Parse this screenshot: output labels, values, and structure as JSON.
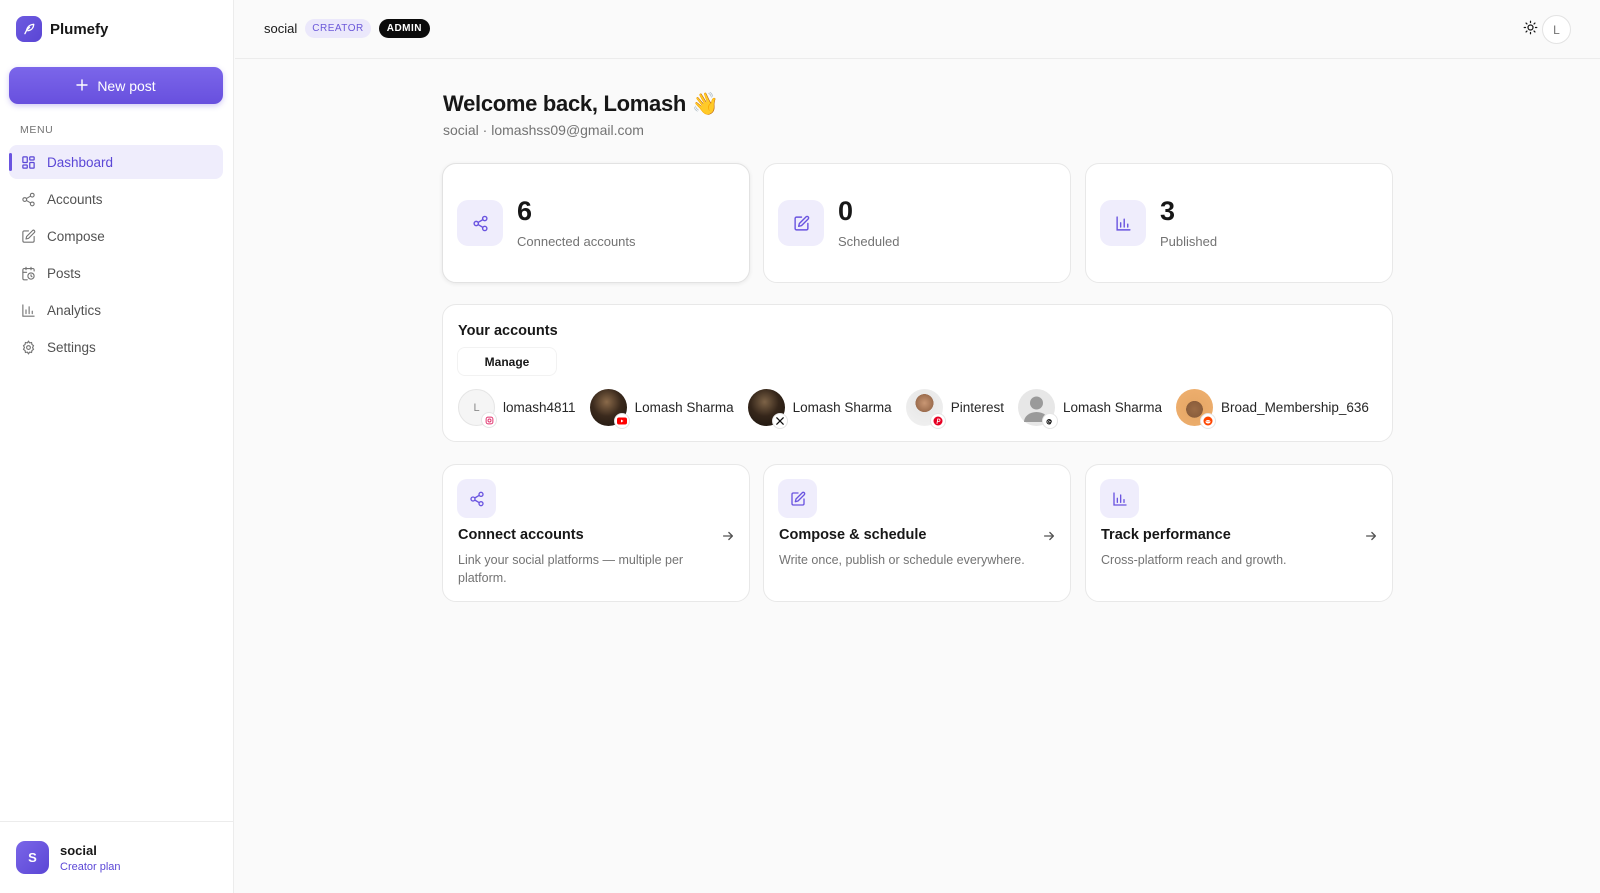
{
  "app": {
    "name": "Plumefy"
  },
  "sidebar": {
    "new_post_label": "New post",
    "menu_label": "MENU",
    "items": [
      {
        "label": "Dashboard",
        "icon": "grid-icon",
        "active": true
      },
      {
        "label": "Accounts",
        "icon": "share-icon"
      },
      {
        "label": "Compose",
        "icon": "edit-icon"
      },
      {
        "label": "Posts",
        "icon": "calendar-clock-icon"
      },
      {
        "label": "Analytics",
        "icon": "bar-chart-icon"
      },
      {
        "label": "Settings",
        "icon": "gear-icon"
      }
    ],
    "footer": {
      "avatar_letter": "S",
      "name": "social",
      "plan": "Creator plan"
    }
  },
  "topbar": {
    "workspace": "social",
    "badge_creator": "CREATOR",
    "badge_admin": "ADMIN",
    "user_letter": "L"
  },
  "main": {
    "welcome": "Welcome back, Lomash 👋",
    "subtitle": "social · lomashss09@gmail.com",
    "stats": [
      {
        "value": "6",
        "label": "Connected accounts",
        "icon": "share-icon"
      },
      {
        "value": "0",
        "label": "Scheduled",
        "icon": "edit-icon"
      },
      {
        "value": "3",
        "label": "Published",
        "icon": "bar-chart-icon"
      }
    ],
    "accounts": {
      "title": "Your accounts",
      "manage_label": "Manage",
      "list": [
        {
          "name": "lomash4811",
          "platform": "instagram",
          "avatar_letter": "L"
        },
        {
          "name": "Lomash Sharma",
          "platform": "youtube"
        },
        {
          "name": "Lomash Sharma",
          "platform": "x"
        },
        {
          "name": "Pinterest",
          "platform": "pinterest"
        },
        {
          "name": "Lomash Sharma",
          "platform": "threads"
        },
        {
          "name": "Broad_Membership_636",
          "platform": "reddit"
        }
      ]
    },
    "features": [
      {
        "title": "Connect accounts",
        "desc": "Link your social platforms — multiple per platform.",
        "icon": "share-icon"
      },
      {
        "title": "Compose & schedule",
        "desc": "Write once, publish or schedule everywhere.",
        "icon": "edit-icon"
      },
      {
        "title": "Track performance",
        "desc": "Cross-platform reach and growth.",
        "icon": "bar-chart-icon"
      }
    ]
  },
  "colors": {
    "accent": "#6a54e0",
    "accent_soft": "#efedfc",
    "background": "#fafafa"
  }
}
